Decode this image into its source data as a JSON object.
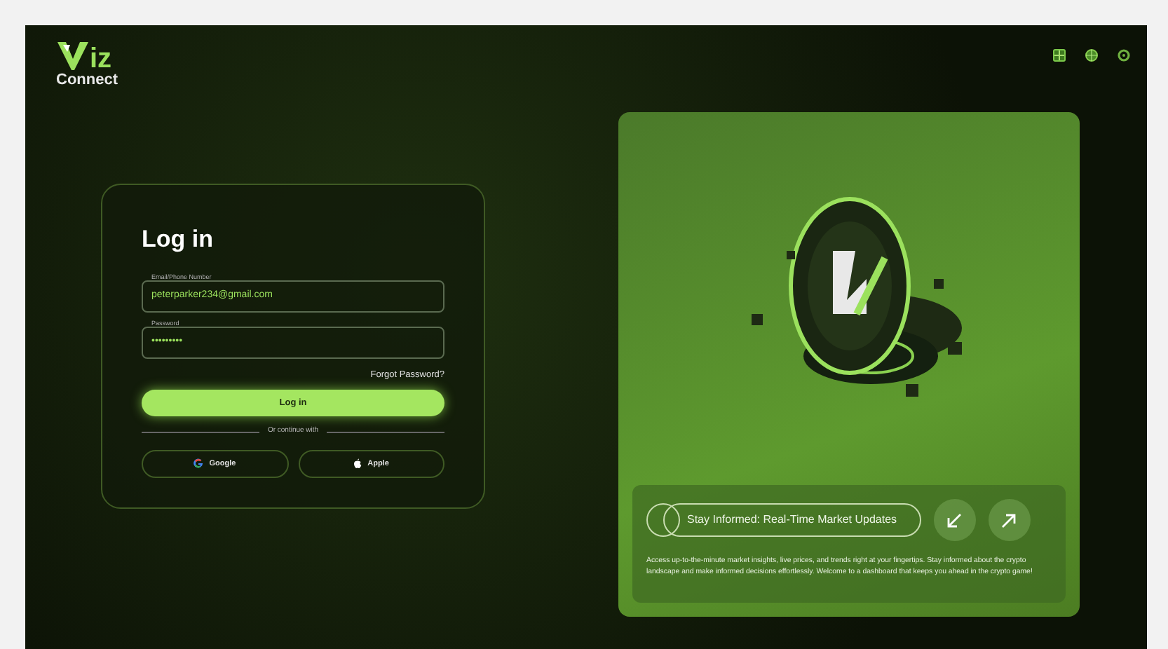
{
  "logo": {
    "line_1": "iz",
    "line_2": "Connect"
  },
  "login": {
    "title": "Log in",
    "email": {
      "label": "Email/Phone Number",
      "value": "peterparker234@gmail.com"
    },
    "password": {
      "label": "Password",
      "value": "•••••••••"
    },
    "forgot": "Forgot Password?",
    "submit": "Log in",
    "divider": "Or continue with",
    "social": [
      {
        "kind": "google",
        "label": "Google"
      },
      {
        "kind": "apple",
        "label": "Apple"
      }
    ]
  },
  "promo": {
    "headline": "Stay Informed: Real-Time Market Updates",
    "text": "Access up-to-the-minute market insights, live prices, and trends right at your fingertips. Stay informed about the crypto landscape and make informed decisions effortlessly. Welcome to a dashboard that keeps you ahead in the crypto game!"
  }
}
